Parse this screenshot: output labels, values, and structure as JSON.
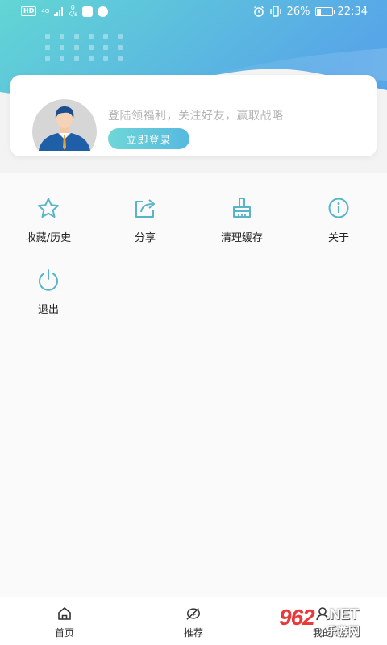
{
  "status_bar": {
    "hd": "HD",
    "network": "4G",
    "speed_value": "0",
    "speed_unit": "K/s",
    "battery": "26%",
    "time": "22:34",
    "icons": [
      "alarm-icon",
      "vibrate-icon",
      "battery-icon"
    ]
  },
  "login_card": {
    "tip": "登陆领福利，关注好友，赢取战略",
    "button_label": "立即登录"
  },
  "menu": [
    {
      "label": "收藏/历史",
      "icon": "star-icon"
    },
    {
      "label": "分享",
      "icon": "share-icon"
    },
    {
      "label": "清理缓存",
      "icon": "brush-icon"
    },
    {
      "label": "关于",
      "icon": "info-icon"
    },
    {
      "label": "退出",
      "icon": "power-icon"
    }
  ],
  "bottom_nav": [
    {
      "label": "首页",
      "icon": "home-icon"
    },
    {
      "label": "推荐",
      "icon": "leaf-icon"
    },
    {
      "label": "我的",
      "icon": "user-icon"
    }
  ],
  "watermark": {
    "logo": "962",
    "net": ".NET",
    "sub": "乐游网"
  },
  "colors": {
    "accent": "#58c6dc",
    "header_start": "#5fd3d6",
    "header_end": "#55a8e6"
  }
}
